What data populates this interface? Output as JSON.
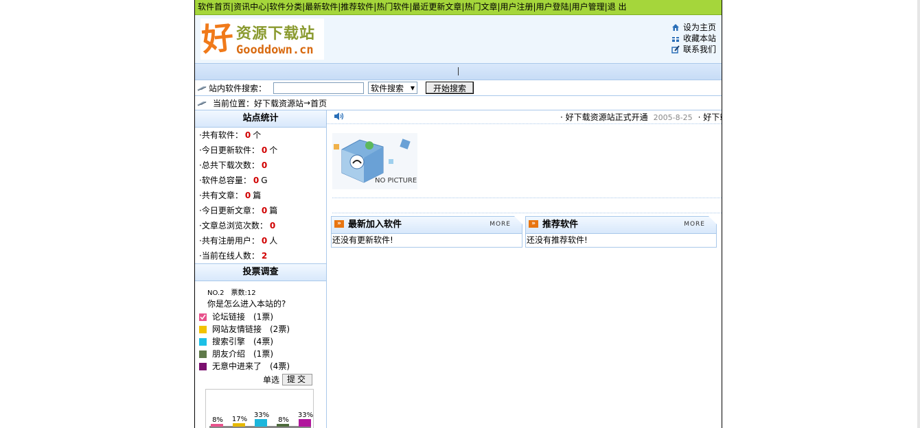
{
  "nav": {
    "items": [
      "软件首页",
      "资讯中心",
      "软件分类",
      "最新软件",
      "推荐软件",
      "热门软件",
      "最近更新文章",
      "热门文章",
      "用户注册",
      "用户登陆",
      "用户管理",
      "退 出"
    ]
  },
  "header": {
    "logo_cn": "资源下载站",
    "logo_mark": "好",
    "logo_en": "Gooddown.cn",
    "links": [
      {
        "label": "设为主页",
        "icon": "home-icon"
      },
      {
        "label": "收藏本站",
        "icon": "gift-icon"
      },
      {
        "label": "联系我们",
        "icon": "edit-icon"
      }
    ]
  },
  "search": {
    "label": "站内软件搜索：",
    "value": "",
    "select_value": "软件搜索",
    "button": "开始搜索"
  },
  "breadcrumb": {
    "label": "当前位置：",
    "link": "好下载资源站",
    "arrow": "→",
    "current": "首页"
  },
  "stats": {
    "title": "站点统计",
    "rows": [
      {
        "label": "共有软件：",
        "value": "0",
        "unit": "个"
      },
      {
        "label": "今日更新软件：",
        "value": "0",
        "unit": "个"
      },
      {
        "label": "总共下载次数：",
        "value": "0",
        "unit": ""
      },
      {
        "label": "软件总容量：",
        "value": "0",
        "unit": "G"
      },
      {
        "label": "共有文章：",
        "value": "0",
        "unit": "篇"
      },
      {
        "label": "今日更新文章：",
        "value": "0",
        "unit": "篇"
      },
      {
        "label": "文章总浏览次数：",
        "value": "0",
        "unit": ""
      },
      {
        "label": "共有注册用户：",
        "value": "0",
        "unit": "人"
      },
      {
        "label": "当前在线人数：",
        "value": "2",
        "unit": ""
      }
    ]
  },
  "vote": {
    "title": "投票调查",
    "meta": "NO.2　票数:12",
    "question": "你是怎么进入本站的?",
    "options": [
      {
        "label": "论坛链接　(1票)",
        "color": "#e8528c",
        "checked": true
      },
      {
        "label": "网站友情链接　(2票)",
        "color": "#f2c200",
        "checked": false
      },
      {
        "label": "搜索引擎　(4票)",
        "color": "#1cc0e6",
        "checked": false
      },
      {
        "label": "朋友介绍　(1票)",
        "color": "#5f7a4a",
        "checked": false
      },
      {
        "label": "无意中进来了　(4票)",
        "color": "#7a0f6e",
        "checked": false
      }
    ],
    "mode": "单选",
    "submit": "提交",
    "chart": {
      "type": "bar",
      "values": [
        8,
        17,
        33,
        8,
        33
      ],
      "labels": [
        "8%",
        "17%",
        "33%",
        "8%",
        "33%"
      ],
      "colors": [
        "#e8528c",
        "#e6b800",
        "#1cb6dc",
        "#4d6b3c",
        "#b0169c"
      ]
    }
  },
  "news": {
    "items": [
      {
        "title": "好下载资源站正式开通",
        "date": "2005-8-25"
      },
      {
        "title": "好下载资源站正式开通",
        "date": ""
      }
    ]
  },
  "nopic": {
    "text": "NO PICTURE"
  },
  "panels": [
    {
      "title": "最新加入软件",
      "more": "MORE",
      "empty": "还没有更新软件!"
    },
    {
      "title": "推荐软件",
      "more": "MORE",
      "empty": "还没有推荐软件!"
    }
  ]
}
